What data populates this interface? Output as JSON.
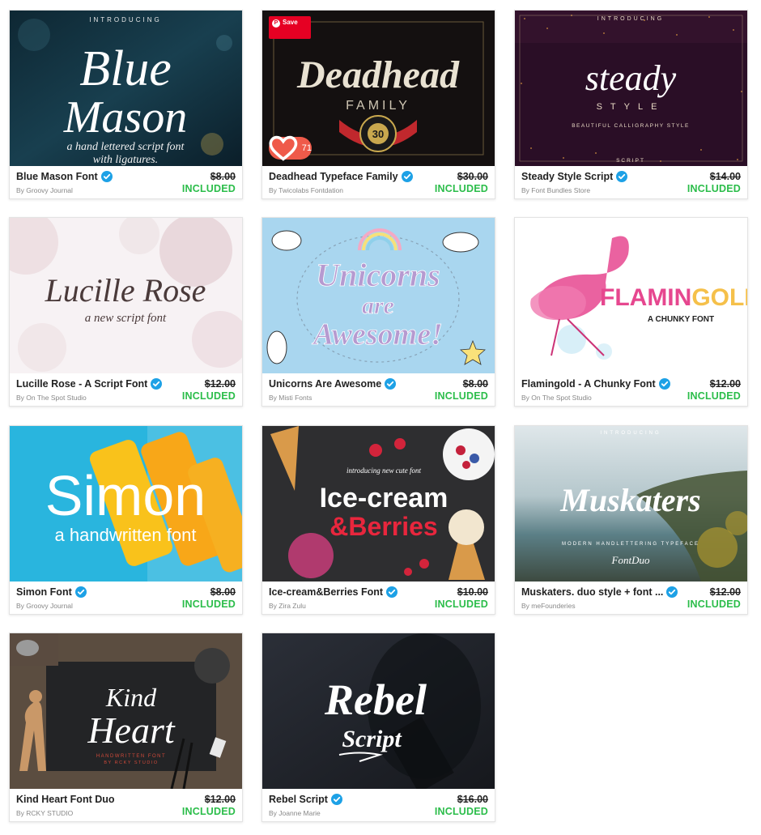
{
  "colors": {
    "included_green": "#2bbd4a",
    "verified_blue": "#1da1e6",
    "pinterest_red": "#e60023",
    "like_red": "#ef5a4a"
  },
  "overlay": {
    "save_label": "Save",
    "like_count": "71"
  },
  "products": [
    {
      "title": "Blue Mason Font",
      "author": "By Groovy Journal",
      "price": "$8.00",
      "status": "INCLUDED",
      "art": {
        "top": "INTRODUCING",
        "line1": "Blue",
        "line2": "Mason",
        "line3": "a hand lettered script font",
        "line4": "with ligatures."
      }
    },
    {
      "title": "Deadhead Typeface Family",
      "author": "By Twicolabs Fontdation",
      "price": "$30.00",
      "status": "INCLUDED",
      "art": {
        "line1": "Deadhead",
        "line2": "FAMILY",
        "line3": "30"
      }
    },
    {
      "title": "Steady Style Script",
      "author": "By Font Bundles Store",
      "price": "$14.00",
      "status": "INCLUDED",
      "art": {
        "top": "INTRODUCING",
        "line1": "steady",
        "line2": "STYLE",
        "line3": "BEAUTIFUL CALLIGRAPHY STYLE",
        "line4": "SCRIPT"
      }
    },
    {
      "title": "Lucille Rose - A Script Font",
      "author": "By On The Spot Studio",
      "price": "$12.00",
      "status": "INCLUDED",
      "art": {
        "line1": "Lucille Rose",
        "line2": "a new script font"
      }
    },
    {
      "title": "Unicorns Are Awesome",
      "author": "By Misti Fonts",
      "price": "$8.00",
      "status": "INCLUDED",
      "art": {
        "line1": "Unicorns",
        "line2": "are",
        "line3": "Awesome!"
      }
    },
    {
      "title": "Flamingold - A Chunky Font",
      "author": "By On The Spot Studio",
      "price": "$12.00",
      "status": "INCLUDED",
      "art": {
        "line1": "FLAMIN",
        "line2": "GOLD",
        "line3": "A CHUNKY FONT"
      }
    },
    {
      "title": "Simon Font",
      "author": "By Groovy Journal",
      "price": "$8.00",
      "status": "INCLUDED",
      "art": {
        "line1": "Simon",
        "line2": "a handwritten font"
      }
    },
    {
      "title": "Ice-cream&Berries Font",
      "author": "By Zira Zulu",
      "price": "$10.00",
      "status": "INCLUDED",
      "art": {
        "top": "introducing new cute font",
        "line1": "Ice-cream",
        "line2": "&Berries"
      }
    },
    {
      "title": "Muskaters. duo style + font ...",
      "author": "By meFounderies",
      "price": "$12.00",
      "status": "INCLUDED",
      "art": {
        "top": "INTRODUCING",
        "line1": "Muskaters",
        "line2": "MODERN HANDLETTERING TYPEFACE",
        "line3": "FontDuo"
      }
    },
    {
      "title": "Kind Heart Font Duo",
      "author": "By RCKY STUDIO",
      "price": "$12.00",
      "status": "INCLUDED",
      "art": {
        "line1": "Kind",
        "line2": "Heart",
        "line3": "HANDWRITTEN FONT",
        "line4": "BY RCKY STUDIO"
      }
    },
    {
      "title": "Rebel Script",
      "author": "By Joanne Marie",
      "price": "$16.00",
      "status": "INCLUDED",
      "art": {
        "line1": "Rebel",
        "line2": "Script"
      }
    }
  ]
}
